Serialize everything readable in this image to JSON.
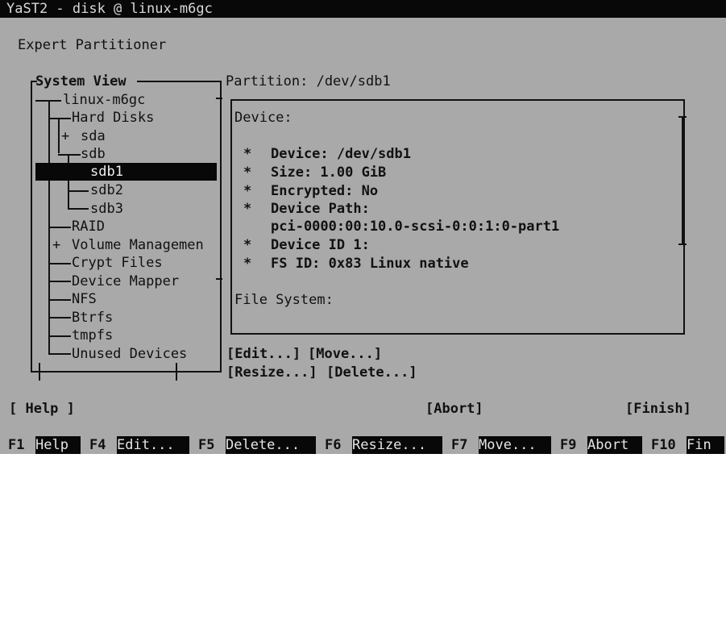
{
  "window": {
    "title": "YaST2 - disk @ linux-m6gc"
  },
  "dialog": {
    "heading": "Expert Partitioner"
  },
  "system_view": {
    "frame_label": "System View",
    "tree": [
      {
        "label": "linux-m6gc"
      },
      {
        "label": "Hard Disks"
      },
      {
        "label": "sda",
        "expander": "+"
      },
      {
        "label": "sdb"
      },
      {
        "label": "sdb1",
        "selected": true
      },
      {
        "label": "sdb2"
      },
      {
        "label": "sdb3"
      },
      {
        "label": "RAID"
      },
      {
        "label": "Volume Managemen",
        "expander": "+"
      },
      {
        "label": "Crypt Files"
      },
      {
        "label": "Device Mapper"
      },
      {
        "label": "NFS"
      },
      {
        "label": "Btrfs"
      },
      {
        "label": "tmpfs"
      },
      {
        "label": "Unused Devices"
      }
    ]
  },
  "partition": {
    "title": "Partition: /dev/sdb1",
    "device_section": "Device:",
    "bullet": "*",
    "items": [
      "Device: /dev/sdb1",
      "Size: 1.00 GiB",
      "Encrypted: No",
      "Device Path:",
      "pci-0000:00:10.0-scsi-0:0:1:0-part1",
      "Device ID 1:",
      "FS ID: 0x83 Linux native"
    ],
    "filesystem_section": "File System:"
  },
  "actions": {
    "edit": "[Edit...]",
    "move": "[Move...]",
    "resize": "[Resize...]",
    "delete": "[Delete...]"
  },
  "buttons": {
    "help": "[ Help ]",
    "abort": "[Abort]",
    "finish": "[Finish]"
  },
  "fkeys": [
    {
      "key": "F1",
      "label": "Help"
    },
    {
      "key": "F4",
      "label": "Edit..."
    },
    {
      "key": "F5",
      "label": "Delete..."
    },
    {
      "key": "F6",
      "label": "Resize..."
    },
    {
      "key": "F7",
      "label": "Move..."
    },
    {
      "key": "F9",
      "label": "Abort"
    },
    {
      "key": "F10",
      "label": "Fin"
    }
  ],
  "colors": {
    "terminal_bg": "#a9a9a9",
    "bar_bg": "#080808",
    "bar_fg": "#e6e6e6"
  }
}
